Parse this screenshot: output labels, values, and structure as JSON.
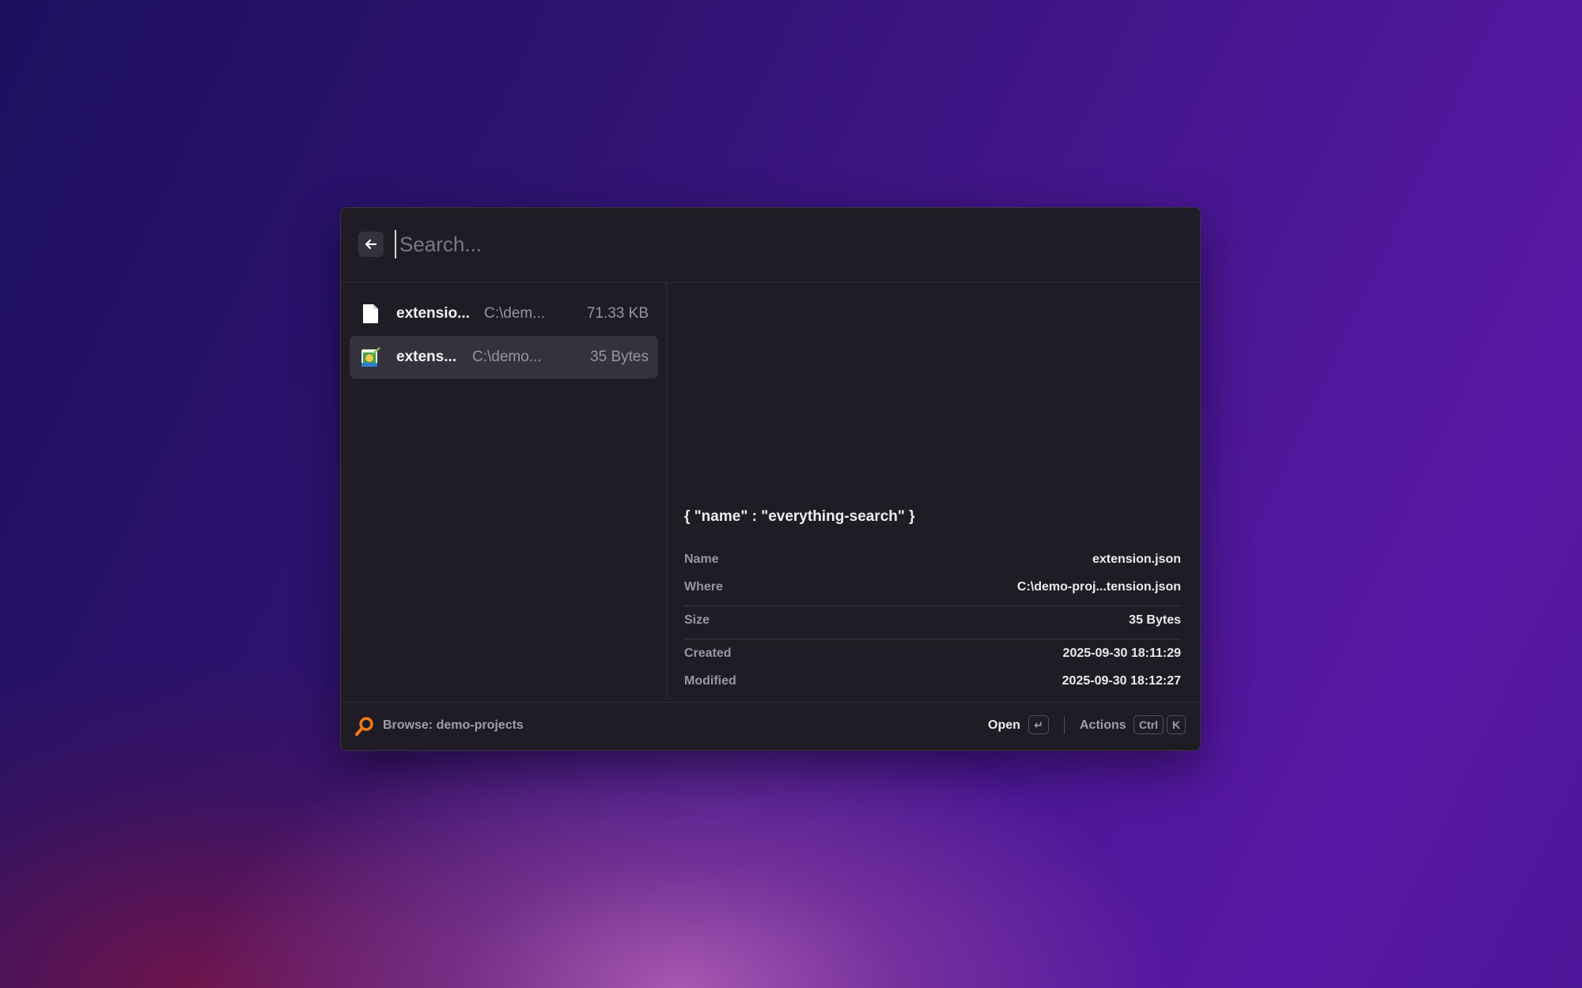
{
  "search": {
    "placeholder": "Search...",
    "value": ""
  },
  "results": [
    {
      "icon": "blank-document-icon",
      "name": "extensio...",
      "path": "C:\\dem...",
      "size": "71.33 KB",
      "selected": false
    },
    {
      "icon": "json-file-icon",
      "name": "extens...",
      "path": "C:\\demo...",
      "size": "35 Bytes",
      "selected": true
    }
  ],
  "preview": {
    "content": "{ \"name\" : \"everything-search\" }"
  },
  "metadata": {
    "name_label": "Name",
    "name_value": "extension.json",
    "where_label": "Where",
    "where_value": "C:\\demo-proj...tension.json",
    "size_label": "Size",
    "size_value": "35 Bytes",
    "created_label": "Created",
    "created_value": "2025-09-30 18:11:29",
    "modified_label": "Modified",
    "modified_value": "2025-09-30 18:12:27"
  },
  "footer": {
    "app_icon": "magnifier-icon",
    "browse_label": "Browse: demo-projects",
    "open_label": "Open",
    "open_key": "↵",
    "actions_label": "Actions",
    "actions_key_1": "Ctrl",
    "actions_key_2": "K"
  },
  "colors": {
    "accent": "#f07a1a",
    "window_bg": "#1f1c25",
    "selected_row": "#35313d"
  }
}
